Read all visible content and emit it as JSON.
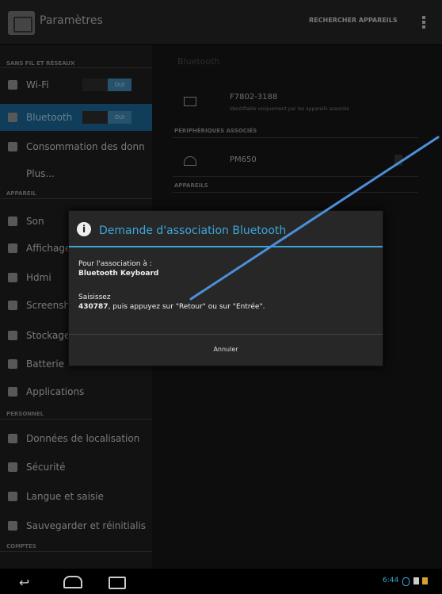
{
  "actionbar": {
    "title": "Paramètres",
    "search_button": "RECHERCHER APPAREILS",
    "app_icon": "settings-icon",
    "overflow_icon": "overflow-menu-icon"
  },
  "sidebar": {
    "section_wireless": "SANS FIL ET RÉSEAUX",
    "section_device": "APPAREIL",
    "section_personal": "PERSONNEL",
    "section_accounts": "COMPTES",
    "items": [
      {
        "label": "Wi-Fi",
        "icon": "wifi-icon",
        "toggle": "OUI"
      },
      {
        "label": "Bluetooth",
        "icon": "bluetooth-icon",
        "toggle": "OUI"
      },
      {
        "label": "Consommation des donn",
        "icon": "data-usage-icon"
      },
      {
        "label": "Plus...",
        "icon": ""
      },
      {
        "label": "Son",
        "icon": "sound-icon"
      },
      {
        "label": "Affichage",
        "icon": "display-icon"
      },
      {
        "label": "Hdmi",
        "icon": "hdmi-icon"
      },
      {
        "label": "Screenshot",
        "icon": "screenshot-icon"
      },
      {
        "label": "Stockage",
        "icon": "storage-icon"
      },
      {
        "label": "Batterie",
        "icon": "battery-icon"
      },
      {
        "label": "Applications",
        "icon": "apps-icon"
      },
      {
        "label": "Données de localisation",
        "icon": "location-icon"
      },
      {
        "label": "Sécurité",
        "icon": "lock-icon"
      },
      {
        "label": "Langue et saisie",
        "icon": "language-icon"
      },
      {
        "label": "Sauvegarder et réinitialis",
        "icon": "backup-icon"
      }
    ]
  },
  "right": {
    "title": "Bluetooth",
    "device_name": "F7802-3188",
    "device_sub": "Identifiable uniquement par les appareils associés",
    "paired_header": "PÉRIPHÉRIQUES ASSOCIÉS",
    "paired_device": "PM650",
    "devices_header": "APPAREILS"
  },
  "dialog": {
    "title": "Demande d'association Bluetooth",
    "line1": "Pour l'association à :",
    "line2": "Bluetooth Keyboard",
    "line3": "Saisissez",
    "pin": "430787",
    "line4": ", puis appuyez sur \"Retour\" ou sur \"Entrée\".",
    "button": "Annuler"
  },
  "navbar": {
    "time": "6:44"
  },
  "colors": {
    "accent": "#3da6d8",
    "annotation_line": "#4a90d9"
  }
}
